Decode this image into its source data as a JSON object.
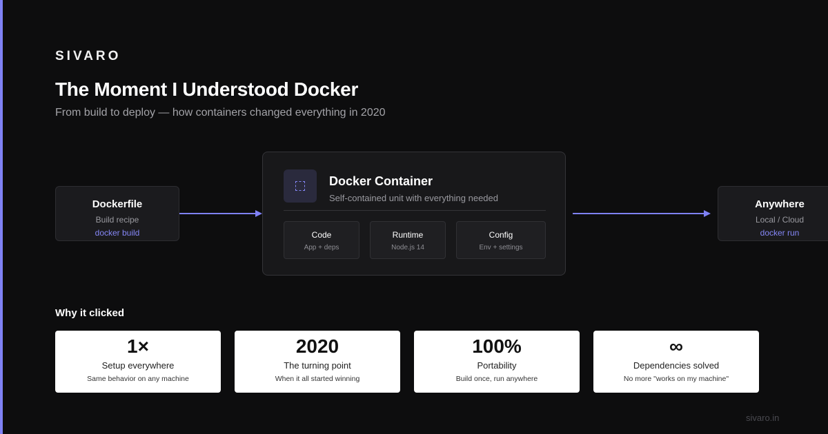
{
  "brand": "SIVARO",
  "title": "The Moment I Understood Docker",
  "subtitle": "From build to deploy — how containers changed everything in 2020",
  "diagram": {
    "source": {
      "title": "Dockerfile",
      "sub": "Build recipe",
      "command": "docker build"
    },
    "container": {
      "title": "Docker Container",
      "sub": "Self-contained unit with everything needed",
      "icon": "container-icon",
      "cells": [
        {
          "label": "Code",
          "value": "App + deps"
        },
        {
          "label": "Runtime",
          "value": "Node.js 14"
        },
        {
          "label": "Config",
          "value": "Env + settings"
        }
      ]
    },
    "target": {
      "title": "Anywhere",
      "sub": "Local / Cloud",
      "command": "docker run"
    },
    "accent_color": "#7f81f5"
  },
  "why": {
    "heading": "Why it clicked",
    "stats": [
      {
        "value": "1×",
        "label": "Setup everywhere",
        "desc": "Same behavior on any machine"
      },
      {
        "value": "2020",
        "label": "The turning point",
        "desc": "When it all started winning"
      },
      {
        "value": "100%",
        "label": "Portability",
        "desc": "Build once, run anywhere"
      },
      {
        "value": "∞",
        "label": "Dependencies solved",
        "desc": "No more \"works on my machine\""
      }
    ]
  },
  "footer": "sivaro.in"
}
